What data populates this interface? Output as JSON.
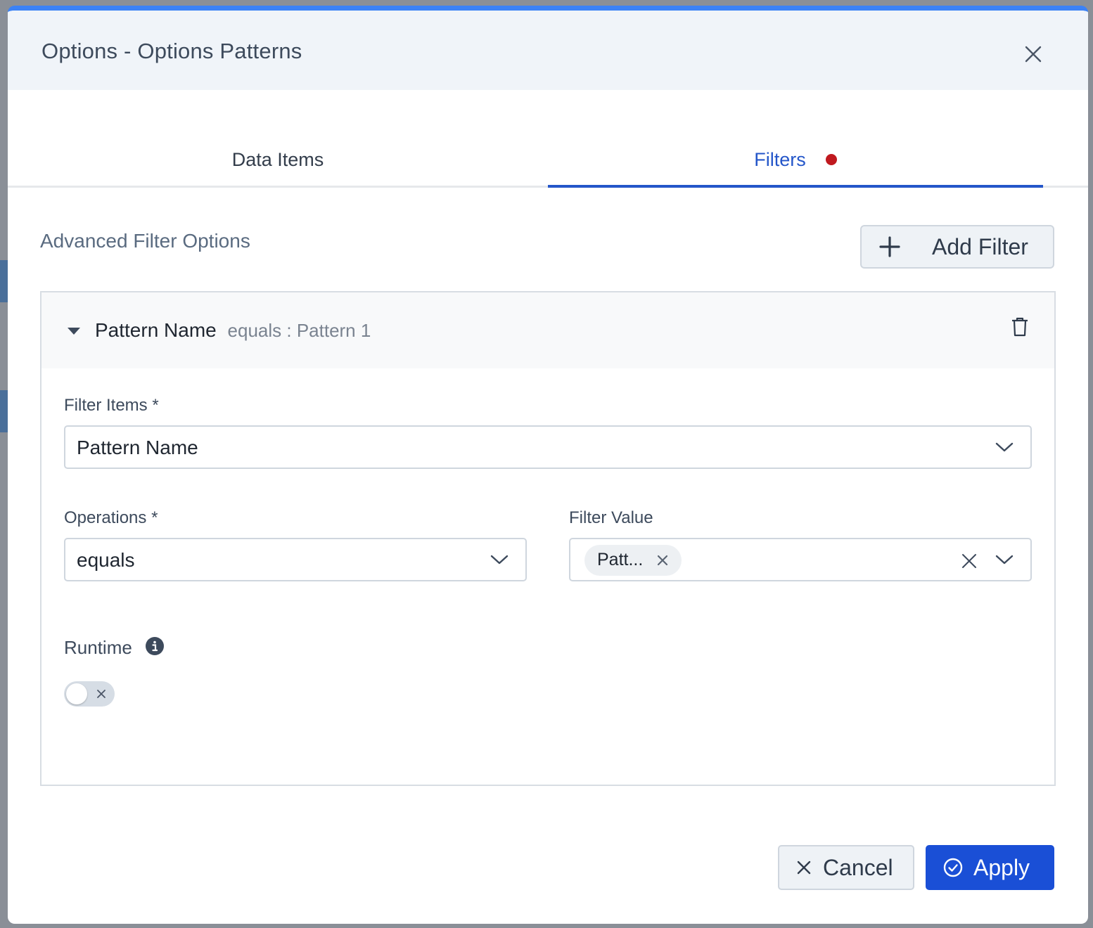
{
  "dialog": {
    "title": "Options - Options Patterns",
    "close_icon": "close-icon"
  },
  "tabs": [
    {
      "label": "Data Items",
      "active": false
    },
    {
      "label": "Filters",
      "active": true,
      "has_indicator_dot": true
    }
  ],
  "filters": {
    "section_title": "Advanced Filter Options",
    "add_button_label": "Add Filter",
    "items": [
      {
        "summary_field": "Pattern Name",
        "summary_condition": "equals : Pattern 1",
        "expanded": true,
        "filter_items_label": "Filter Items *",
        "filter_items_value": "Pattern Name",
        "operations_label": "Operations *",
        "operations_value": "equals",
        "filter_value_label": "Filter Value",
        "filter_value_chip": "Patt...",
        "runtime_label": "Runtime",
        "runtime_enabled": false
      }
    ]
  },
  "footer": {
    "cancel_label": "Cancel",
    "apply_label": "Apply"
  },
  "colors": {
    "accent": "#2456c9",
    "primary_button": "#1a4fd6",
    "indicator_dot": "#c0191f",
    "header_bg": "#f0f4f9"
  }
}
